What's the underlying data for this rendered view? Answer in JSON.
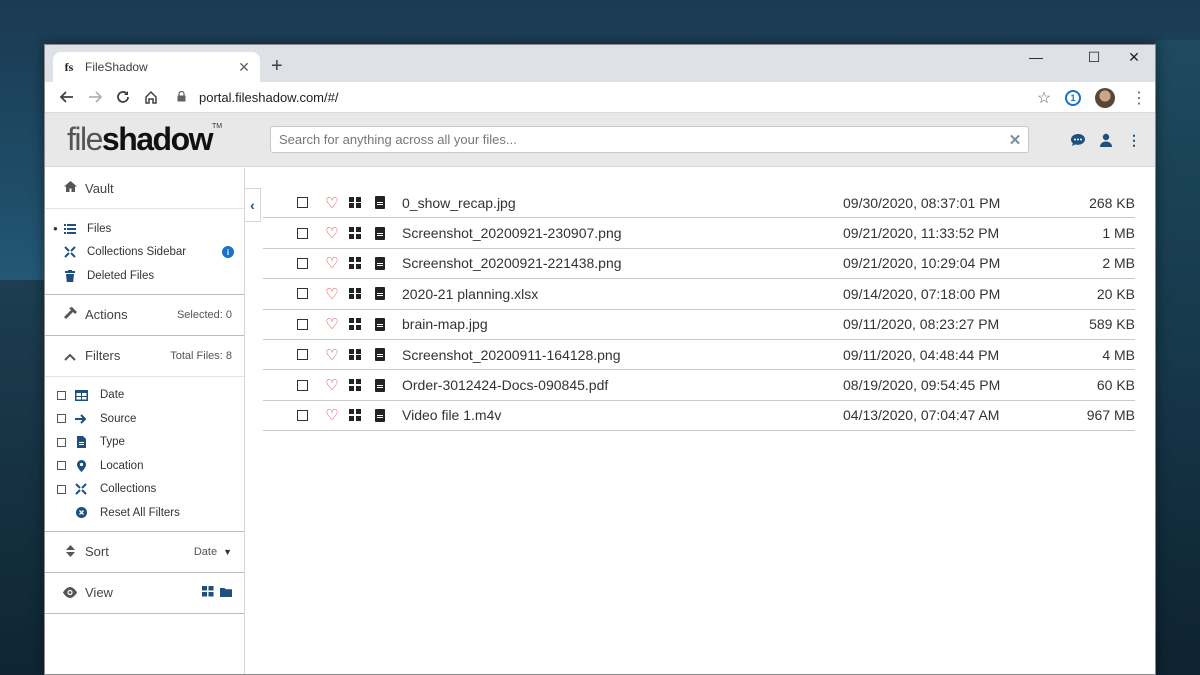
{
  "browser": {
    "tab_title": "FileShadow",
    "tab_favicon": "fs",
    "new_tab": "+",
    "url": "portal.fileshadow.com/#/",
    "minimize": "—",
    "maximize": "☐",
    "close": "✕"
  },
  "app": {
    "logo_light": "file",
    "logo_bold": "shadow",
    "logo_tm": "TM",
    "search_placeholder": "Search for anything across all your files..."
  },
  "sidebar": {
    "vault_label": "Vault",
    "vault_items": [
      {
        "label": "Files",
        "icon": "list-icon",
        "active": true
      },
      {
        "label": "Collections Sidebar",
        "icon": "collections-icon"
      },
      {
        "label": "Deleted Files",
        "icon": "trash-icon"
      }
    ],
    "actions_label": "Actions",
    "actions_meta": "Selected: 0",
    "filters_label": "Filters",
    "filters_meta": "Total Files: 8",
    "filters": [
      {
        "label": "Date",
        "icon": "calendar-icon"
      },
      {
        "label": "Source",
        "icon": "arrow-right-icon"
      },
      {
        "label": "Type",
        "icon": "file-icon"
      },
      {
        "label": "Location",
        "icon": "map-pin-icon"
      },
      {
        "label": "Collections",
        "icon": "collections-icon"
      }
    ],
    "reset_label": "Reset All Filters",
    "sort_label": "Sort",
    "sort_value": "Date",
    "view_label": "View"
  },
  "files": [
    {
      "name": "0_show_recap.jpg",
      "date": "09/30/2020, 08:37:01 PM",
      "size": "268 KB"
    },
    {
      "name": "Screenshot_20200921-230907.png",
      "date": "09/21/2020, 11:33:52 PM",
      "size": "1 MB"
    },
    {
      "name": "Screenshot_20200921-221438.png",
      "date": "09/21/2020, 10:29:04 PM",
      "size": "2 MB"
    },
    {
      "name": "2020-21 planning.xlsx",
      "date": "09/14/2020, 07:18:00 PM",
      "size": "20 KB"
    },
    {
      "name": "brain-map.jpg",
      "date": "09/11/2020, 08:23:27 PM",
      "size": "589 KB"
    },
    {
      "name": "Screenshot_20200911-164128.png",
      "date": "09/11/2020, 04:48:44 PM",
      "size": "4 MB"
    },
    {
      "name": "Order-3012424-Docs-090845.pdf",
      "date": "08/19/2020, 09:54:45 PM",
      "size": "60 KB"
    },
    {
      "name": "Video file 1.m4v",
      "date": "04/13/2020, 07:04:47 AM",
      "size": "967 MB"
    }
  ],
  "colors": {
    "accent": "#1d4f7f",
    "heart": "#d62828",
    "header_bg": "#e8e8e8",
    "tabstrip": "#dee1e6"
  }
}
